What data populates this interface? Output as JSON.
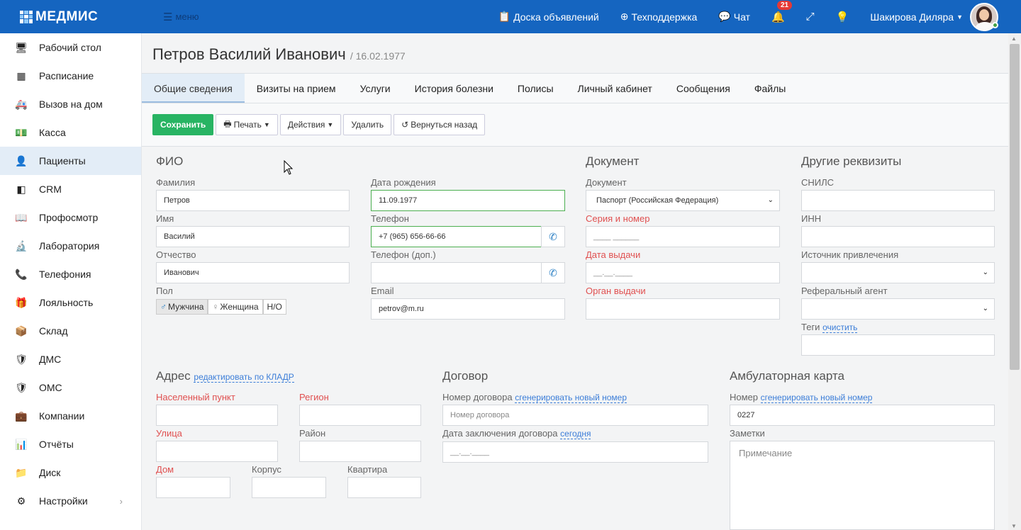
{
  "app": {
    "logo": "МЕДМИС",
    "menu_label": "меню"
  },
  "topbar": {
    "board": "Доска объявлений",
    "support": "Техподдержка",
    "chat": "Чат",
    "notifications_count": "21",
    "user_name": "Шакирова Диляра"
  },
  "sidebar": {
    "items": [
      {
        "label": "Рабочий стол",
        "icon": "desktop-icon"
      },
      {
        "label": "Расписание",
        "icon": "calendar-icon"
      },
      {
        "label": "Вызов на дом",
        "icon": "ambulance-icon"
      },
      {
        "label": "Касса",
        "icon": "cash-icon"
      },
      {
        "label": "Пациенты",
        "icon": "patients-icon"
      },
      {
        "label": "CRM",
        "icon": "crm-icon"
      },
      {
        "label": "Профосмотр",
        "icon": "book-icon"
      },
      {
        "label": "Лаборатория",
        "icon": "microscope-icon"
      },
      {
        "label": "Телефония",
        "icon": "phone-icon"
      },
      {
        "label": "Лояльность",
        "icon": "gift-icon"
      },
      {
        "label": "Склад",
        "icon": "box-icon"
      },
      {
        "label": "ДМС",
        "icon": "shield-icon"
      },
      {
        "label": "ОМС",
        "icon": "shield-icon"
      },
      {
        "label": "Компании",
        "icon": "briefcase-icon"
      },
      {
        "label": "Отчёты",
        "icon": "chart-icon"
      },
      {
        "label": "Диск",
        "icon": "folder-icon"
      },
      {
        "label": "Настройки",
        "icon": "gear-icon"
      }
    ]
  },
  "patient": {
    "name": "Петров Василий Иванович",
    "dob": "/ 16.02.1977"
  },
  "tabs": [
    "Общие сведения",
    "Визиты на прием",
    "Услуги",
    "История болезни",
    "Полисы",
    "Личный кабинет",
    "Сообщения",
    "Файлы"
  ],
  "toolbar": {
    "save": "Сохранить",
    "print": "Печать",
    "actions": "Действия",
    "delete": "Удалить",
    "back": "Вернуться назад"
  },
  "fio": {
    "title": "ФИО",
    "last_name_label": "Фамилия",
    "last_name": "Петров",
    "first_name_label": "Имя",
    "first_name": "Василий",
    "patronymic_label": "Отчество",
    "patronymic": "Иванович",
    "sex_label": "Пол",
    "sex_male": "Мужчина",
    "sex_female": "Женщина",
    "sex_na": "Н/О"
  },
  "contacts": {
    "dob_label": "Дата рождения",
    "dob": "11.09.1977",
    "phone_label": "Телефон",
    "phone": "+7 (965) 656-66-66",
    "phone2_label": "Телефон (доп.)",
    "phone2": "",
    "email_label": "Email",
    "email": "petrov@m.ru"
  },
  "document": {
    "title": "Документ",
    "doc_label": "Документ",
    "doc_value": "Паспорт (Российская Федерация)",
    "series_label": "Серия и номер",
    "series_placeholder": "____ ______",
    "issue_date_label": "Дата выдачи",
    "issue_date_placeholder": "__.__.____",
    "issuer_label": "Орган выдачи",
    "issuer": ""
  },
  "other": {
    "title": "Другие реквизиты",
    "snils_label": "СНИЛС",
    "inn_label": "ИНН",
    "source_label": "Источник привлечения",
    "agent_label": "Реферальный агент",
    "tags_label": "Теги",
    "tags_clear": "очистить"
  },
  "address": {
    "title": "Адрес",
    "edit_link": "редактировать по КЛАДР",
    "city_label": "Населенный пункт",
    "region_label": "Регион",
    "street_label": "Улица",
    "district_label": "Район",
    "house_label": "Дом",
    "building_label": "Корпус",
    "apartment_label": "Квартира"
  },
  "contract": {
    "title": "Договор",
    "number_label": "Номер договора",
    "number_link": "сгенерировать новый номер",
    "number_placeholder": "Номер договора",
    "date_label": "Дата заключения договора",
    "date_link": "сегодня",
    "date_placeholder": "__.__.____"
  },
  "card": {
    "title": "Амбулаторная карта",
    "number_label": "Номер",
    "number_link": "сгенерировать новый номер",
    "number": "0227",
    "notes_label": "Заметки",
    "notes_placeholder": "Примечание"
  },
  "colors": {
    "topbar": "#1565c0",
    "save": "#28b463",
    "required": "#e05050",
    "link": "#3b7dd8"
  }
}
